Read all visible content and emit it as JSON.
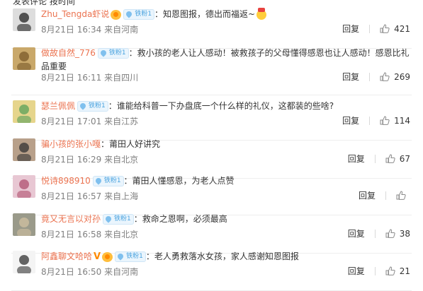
{
  "top_partial": "发表评论  按时间",
  "comments": [
    {
      "username": "Zhu_Tengda虾说",
      "fan_badge": "铁粉1",
      "text": "：知恩图报，德出而福返~",
      "date": "8月21日 16:34",
      "location": "来自河南",
      "reply_label": "回复",
      "likes": "421",
      "avatar_color": "#dddddd",
      "avatar_fg": "#222222"
    },
    {
      "username": "做故自然_776",
      "fan_badge": "铁粉1",
      "text": "：救小孩的老人让人感动！被救孩子的父母懂得感恩也让人感动！感恩比礼",
      "text2": "品重要",
      "date": "8月21日 16:11",
      "location": "来自四川",
      "reply_label": "回复",
      "likes": "269",
      "avatar_color": "#c9a86a",
      "avatar_fg": "#7a5a2a"
    },
    {
      "username": "瑟兰佩佩",
      "fan_badge": "铁粉1",
      "text": "：谁能给科普一下办盘底一个什么样的礼仪，这都装的些啥?",
      "date": "8月21日 17:01",
      "location": "来自江苏",
      "reply_label": "回复",
      "likes": "114",
      "avatar_color": "#e6d58c",
      "avatar_fg": "#5aa05a"
    },
    {
      "username": "骗小孩的张小嘎",
      "text": "：莆田人好讲究",
      "date": "8月21日 16:29",
      "location": "来自北京",
      "reply_label": "回复",
      "likes": "67",
      "avatar_color": "#b8a08a",
      "avatar_fg": "#333333"
    },
    {
      "username": "悦诗898910",
      "fan_badge": "铁粉1",
      "text": "：莆田人懂感恩，为老人点赞",
      "date": "8月21日 16:57",
      "location": "来自上海",
      "reply_label": "回复",
      "likes": "",
      "avatar_color": "#e8c7d3",
      "avatar_fg": "#b05070"
    },
    {
      "username": "竟又无言以对孙",
      "fan_badge": "铁粉1",
      "text": "：救命之恩啊，必须最高",
      "date": "8月21日 16:58",
      "location": "来自北京",
      "reply_label": "回复",
      "likes": "38",
      "avatar_color": "#9a9a8a",
      "avatar_fg": "#d0c0a0"
    },
    {
      "username": "阿鑫聊文哈哈",
      "fan_badge": "铁粉1",
      "text": "：老人勇救落水女孩，家人感谢知恩图报",
      "date": "8月21日 16:50",
      "location": "来自河南",
      "reply_label": "回复",
      "likes": "21",
      "avatar_color": "#f4f4f4",
      "avatar_fg": "#333333",
      "avatar_text": "阿鑫 聊文"
    }
  ]
}
